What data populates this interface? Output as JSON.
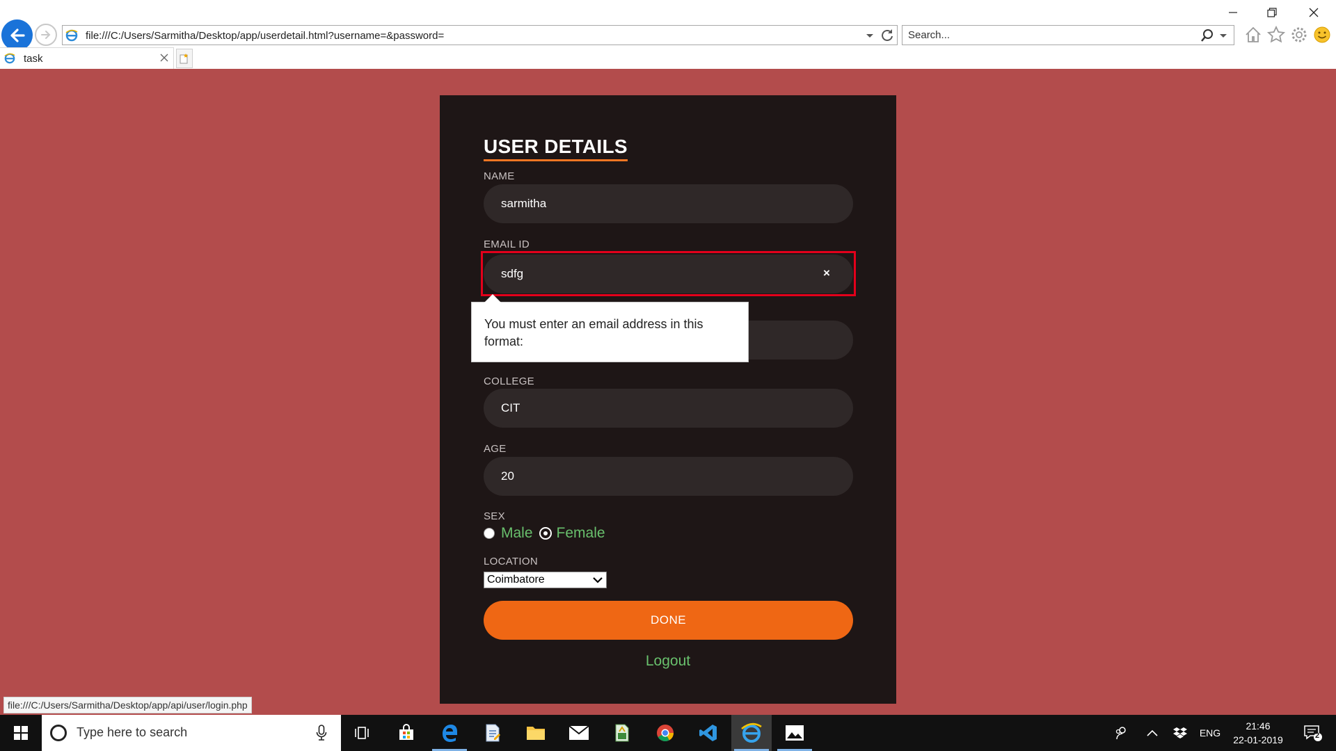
{
  "browser": {
    "url": "file:///C:/Users/Sarmitha/Desktop/app/userdetail.html?username=&password=",
    "search_placeholder": "Search...",
    "tab_title": "task",
    "status_url": "file:///C:/Users/Sarmitha/Desktop/app/api/user/login.php"
  },
  "form": {
    "heading": "USER DETAILS",
    "name_label": "NAME",
    "name_value": "sarmitha",
    "email_label": "EMAIL ID",
    "email_value": "sdfg",
    "email_clear": "×",
    "email_tooltip": "You must enter an email address in this format:",
    "college_label": "COLLEGE",
    "college_value": "CIT",
    "age_label": "AGE",
    "age_value": "20",
    "sex_label": "SEX",
    "sex_options": [
      "Male",
      "Female"
    ],
    "sex_selected": "Female",
    "location_label": "LOCATION",
    "location_value": "Coimbatore",
    "done_label": "DONE",
    "logout_label": "Logout"
  },
  "taskbar": {
    "search_placeholder": "Type here to search",
    "language": "ENG",
    "time": "21:46",
    "date": "22-01-2019",
    "notification_count": "2"
  },
  "colors": {
    "page_bg": "#b34c4c",
    "card_bg": "#1e1616",
    "field_bg": "#2f2828",
    "accent_orange": "#ef6714",
    "accent_green": "#69c06d",
    "error_red": "#e3001b"
  }
}
